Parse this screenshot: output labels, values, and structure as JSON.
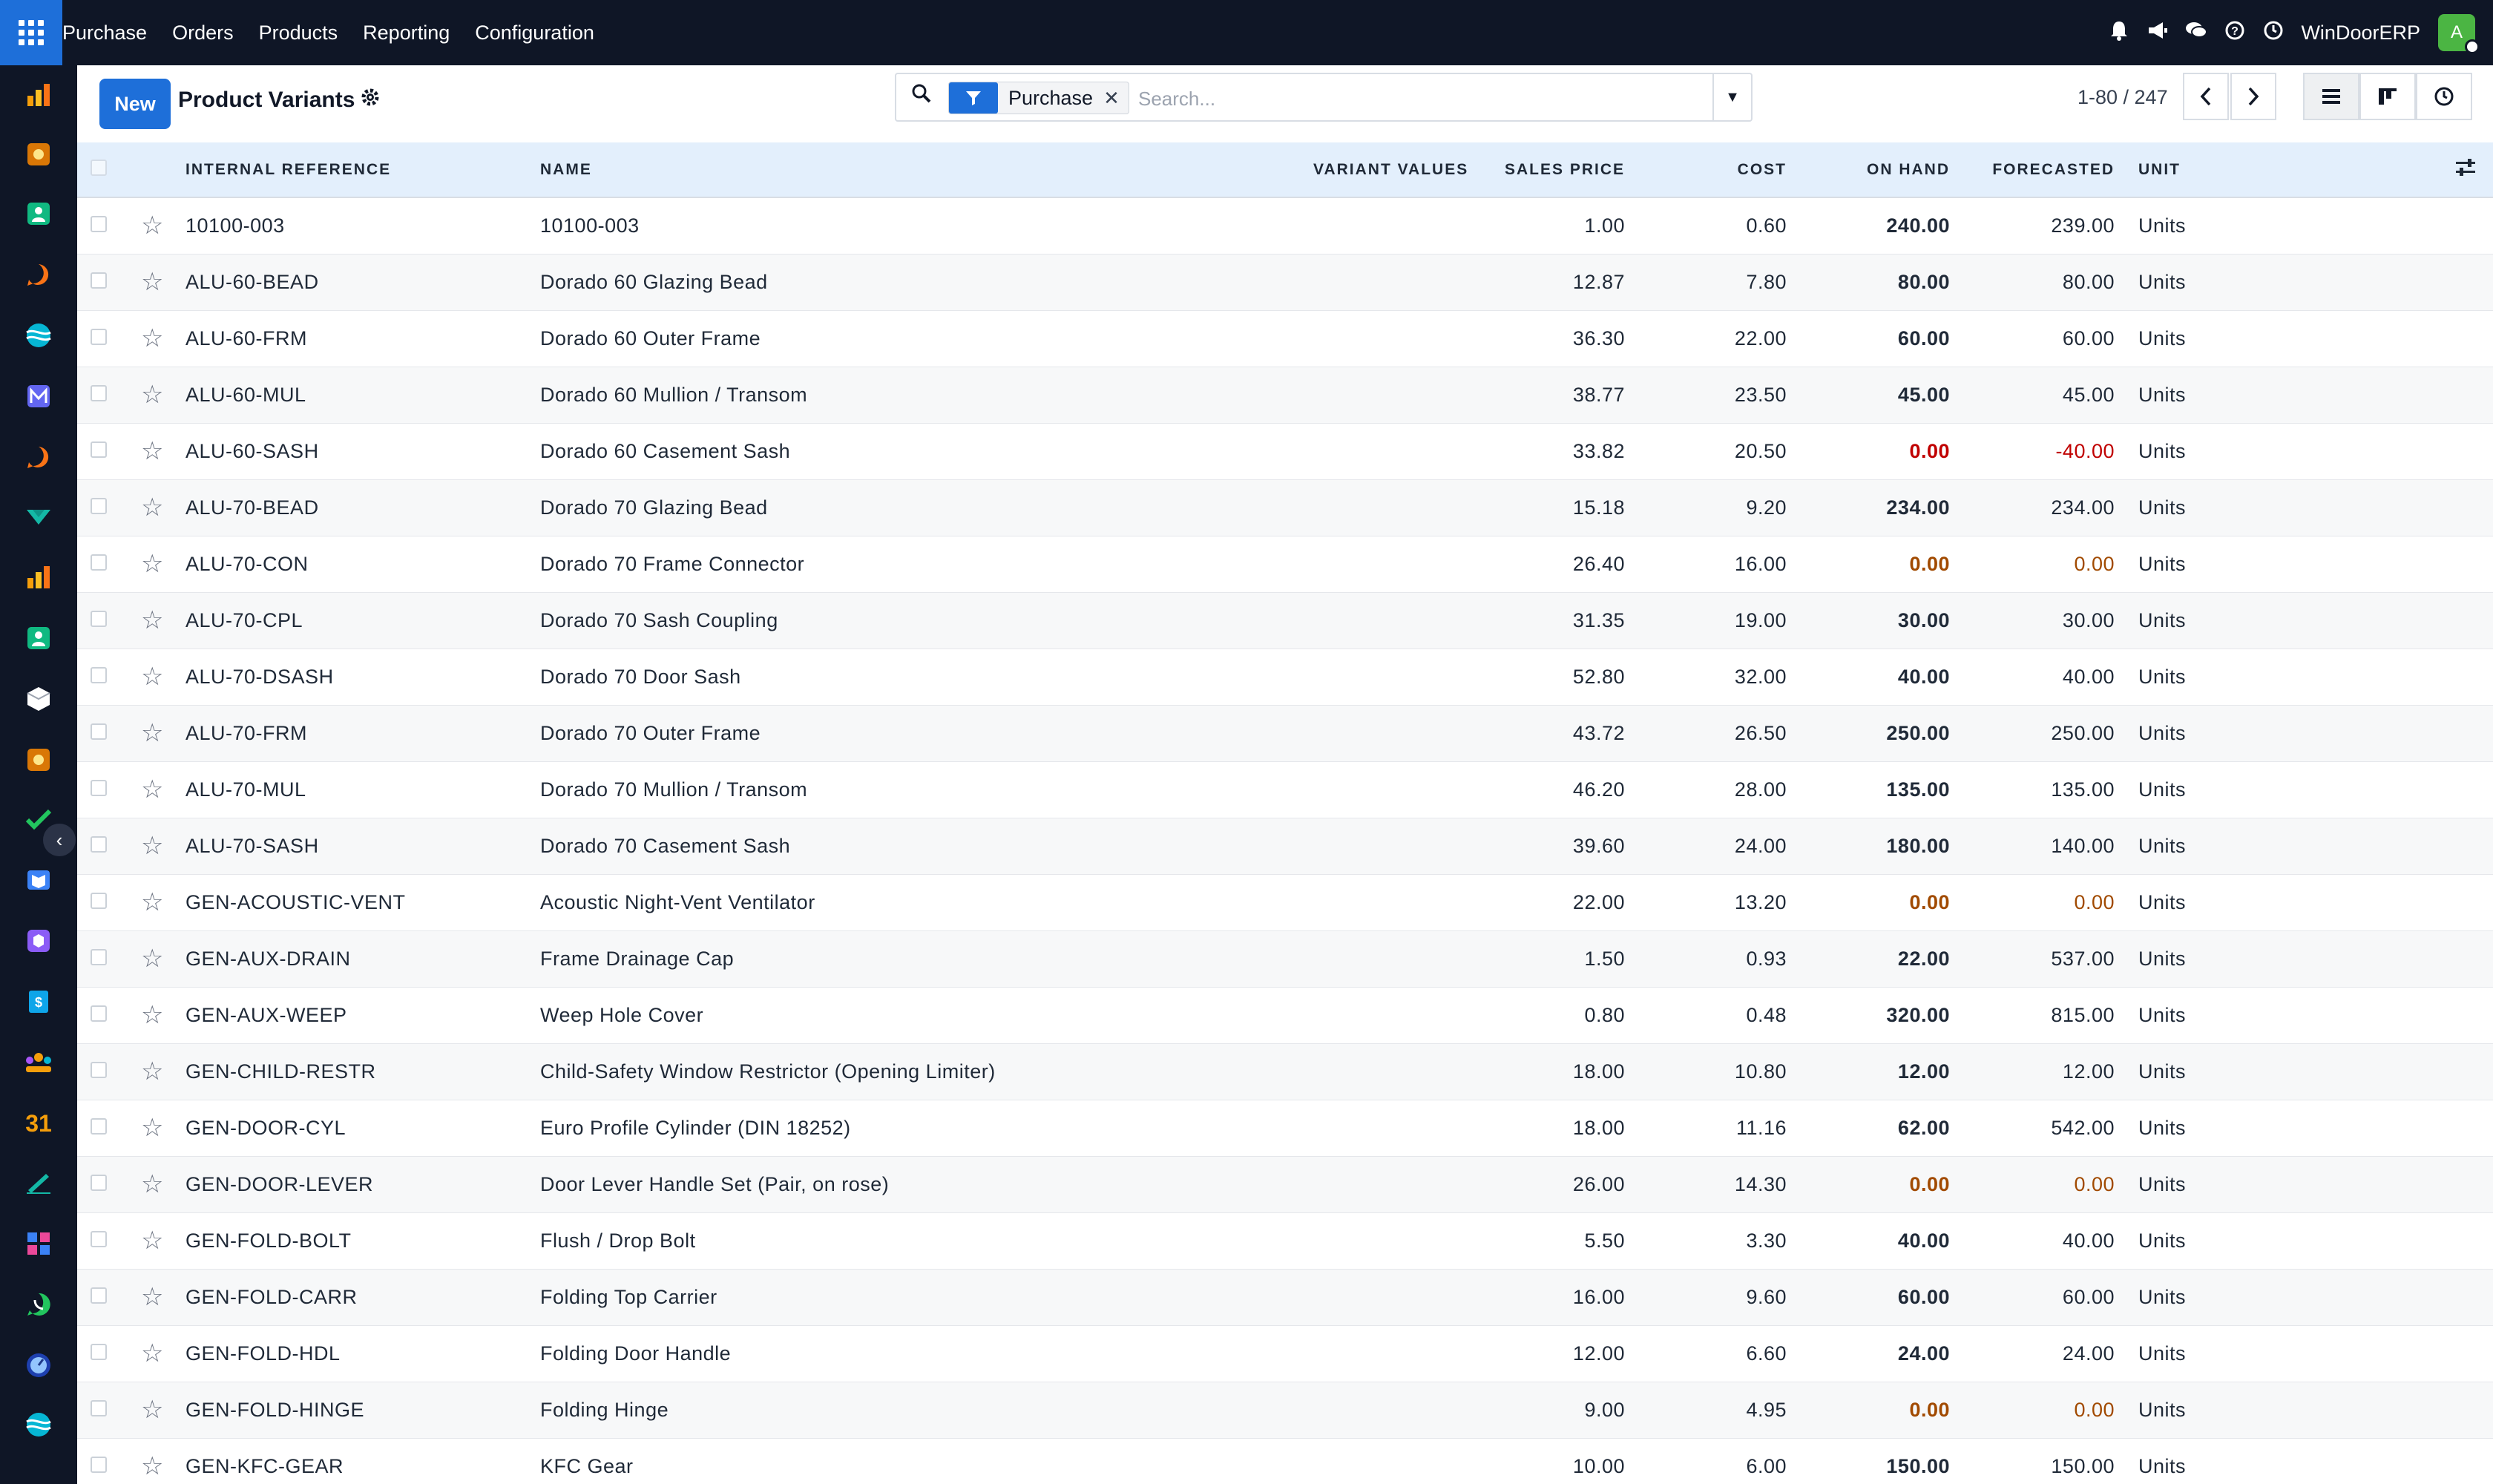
{
  "nav": {
    "brand": "Purchase",
    "menu": [
      "Orders",
      "Products",
      "Reporting",
      "Configuration"
    ],
    "company": "WinDoorERP",
    "avatar_initial": "A",
    "icons": [
      "bell-icon",
      "megaphone-icon",
      "chat-icon",
      "help-icon",
      "clock-icon"
    ]
  },
  "sidebar": {
    "apps": [
      {
        "name": "reporting-app-icon",
        "color": "#f59e0b"
      },
      {
        "name": "studio-app-icon",
        "color": "#d97706"
      },
      {
        "name": "contacts-app-icon",
        "color": "#10b981"
      },
      {
        "name": "discuss-app-icon",
        "color": "#f97316"
      },
      {
        "name": "website-app-icon",
        "color": "#06b6d4"
      },
      {
        "name": "mail-app-icon",
        "color": "#6366f1"
      },
      {
        "name": "livechat-app-icon",
        "color": "#f97316"
      },
      {
        "name": "sign-app-icon",
        "color": "#14b8a6"
      },
      {
        "name": "dashboards-app-icon",
        "color": "#f59e0b"
      },
      {
        "name": "employees-app-icon",
        "color": "#10b981"
      },
      {
        "name": "inventory-app-icon",
        "color": "#ffffff"
      },
      {
        "name": "studio2-app-icon",
        "color": "#d97706"
      },
      {
        "name": "project-app-icon",
        "color": "#22c55e"
      },
      {
        "name": "knowledge-app-icon",
        "color": "#3b82f6"
      },
      {
        "name": "repair-app-icon",
        "color": "#8b5cf6"
      },
      {
        "name": "invoicing-app-icon",
        "color": "#0ea5e9"
      },
      {
        "name": "crm-app-icon",
        "color": "#f59e0b"
      },
      {
        "name": "calendar-app-icon",
        "color": "#f59e0b"
      },
      {
        "name": "signature-app-icon",
        "color": "#14b8a6"
      },
      {
        "name": "spreadsheet-app-icon",
        "color": "#3b82f6"
      },
      {
        "name": "whatsapp-app-icon",
        "color": "#22c55e"
      },
      {
        "name": "timer-app-icon",
        "color": "#3b82f6"
      },
      {
        "name": "website2-app-icon",
        "color": "#06b6d4"
      }
    ]
  },
  "control": {
    "new_label": "New",
    "title": "Product Variants",
    "facet_label": "Purchase",
    "search_placeholder": "Search...",
    "pager": "1-80 / 247"
  },
  "table": {
    "headers": [
      "INTERNAL REFERENCE",
      "NAME",
      "VARIANT VALUES",
      "SALES PRICE",
      "COST",
      "ON HAND",
      "FORECASTED",
      "UNIT"
    ],
    "rows": [
      {
        "ref": "10100-003",
        "name": "10100-003",
        "variant": "",
        "price": "1.00",
        "cost": "0.60",
        "onhand": "240.00",
        "forecast": "239.00",
        "unit": "Units",
        "status": "ok"
      },
      {
        "ref": "ALU-60-BEAD",
        "name": "Dorado 60 Glazing Bead",
        "variant": "",
        "price": "12.87",
        "cost": "7.80",
        "onhand": "80.00",
        "forecast": "80.00",
        "unit": "Units",
        "status": "ok"
      },
      {
        "ref": "ALU-60-FRM",
        "name": "Dorado 60 Outer Frame",
        "variant": "",
        "price": "36.30",
        "cost": "22.00",
        "onhand": "60.00",
        "forecast": "60.00",
        "unit": "Units",
        "status": "ok"
      },
      {
        "ref": "ALU-60-MUL",
        "name": "Dorado 60 Mullion / Transom",
        "variant": "",
        "price": "38.77",
        "cost": "23.50",
        "onhand": "45.00",
        "forecast": "45.00",
        "unit": "Units",
        "status": "ok"
      },
      {
        "ref": "ALU-60-SASH",
        "name": "Dorado 60 Casement Sash",
        "variant": "",
        "price": "33.82",
        "cost": "20.50",
        "onhand": "0.00",
        "forecast": "-40.00",
        "unit": "Units",
        "status": "negative"
      },
      {
        "ref": "ALU-70-BEAD",
        "name": "Dorado 70 Glazing Bead",
        "variant": "",
        "price": "15.18",
        "cost": "9.20",
        "onhand": "234.00",
        "forecast": "234.00",
        "unit": "Units",
        "status": "ok"
      },
      {
        "ref": "ALU-70-CON",
        "name": "Dorado 70 Frame Connector",
        "variant": "",
        "price": "26.40",
        "cost": "16.00",
        "onhand": "0.00",
        "forecast": "0.00",
        "unit": "Units",
        "status": "zero"
      },
      {
        "ref": "ALU-70-CPL",
        "name": "Dorado 70 Sash Coupling",
        "variant": "",
        "price": "31.35",
        "cost": "19.00",
        "onhand": "30.00",
        "forecast": "30.00",
        "unit": "Units",
        "status": "ok"
      },
      {
        "ref": "ALU-70-DSASH",
        "name": "Dorado 70 Door Sash",
        "variant": "",
        "price": "52.80",
        "cost": "32.00",
        "onhand": "40.00",
        "forecast": "40.00",
        "unit": "Units",
        "status": "ok"
      },
      {
        "ref": "ALU-70-FRM",
        "name": "Dorado 70 Outer Frame",
        "variant": "",
        "price": "43.72",
        "cost": "26.50",
        "onhand": "250.00",
        "forecast": "250.00",
        "unit": "Units",
        "status": "ok"
      },
      {
        "ref": "ALU-70-MUL",
        "name": "Dorado 70 Mullion / Transom",
        "variant": "",
        "price": "46.20",
        "cost": "28.00",
        "onhand": "135.00",
        "forecast": "135.00",
        "unit": "Units",
        "status": "ok"
      },
      {
        "ref": "ALU-70-SASH",
        "name": "Dorado 70 Casement Sash",
        "variant": "",
        "price": "39.60",
        "cost": "24.00",
        "onhand": "180.00",
        "forecast": "140.00",
        "unit": "Units",
        "status": "ok"
      },
      {
        "ref": "GEN-ACOUSTIC-VENT",
        "name": "Acoustic Night-Vent Ventilator",
        "variant": "",
        "price": "22.00",
        "cost": "13.20",
        "onhand": "0.00",
        "forecast": "0.00",
        "unit": "Units",
        "status": "zero"
      },
      {
        "ref": "GEN-AUX-DRAIN",
        "name": "Frame Drainage Cap",
        "variant": "",
        "price": "1.50",
        "cost": "0.93",
        "onhand": "22.00",
        "forecast": "537.00",
        "unit": "Units",
        "status": "ok"
      },
      {
        "ref": "GEN-AUX-WEEP",
        "name": "Weep Hole Cover",
        "variant": "",
        "price": "0.80",
        "cost": "0.48",
        "onhand": "320.00",
        "forecast": "815.00",
        "unit": "Units",
        "status": "ok"
      },
      {
        "ref": "GEN-CHILD-RESTR",
        "name": "Child-Safety Window Restrictor (Opening Limiter)",
        "variant": "",
        "price": "18.00",
        "cost": "10.80",
        "onhand": "12.00",
        "forecast": "12.00",
        "unit": "Units",
        "status": "ok"
      },
      {
        "ref": "GEN-DOOR-CYL",
        "name": "Euro Profile Cylinder (DIN 18252)",
        "variant": "",
        "price": "18.00",
        "cost": "11.16",
        "onhand": "62.00",
        "forecast": "542.00",
        "unit": "Units",
        "status": "ok"
      },
      {
        "ref": "GEN-DOOR-LEVER",
        "name": "Door Lever Handle Set (Pair, on rose)",
        "variant": "",
        "price": "26.00",
        "cost": "14.30",
        "onhand": "0.00",
        "forecast": "0.00",
        "unit": "Units",
        "status": "zero"
      },
      {
        "ref": "GEN-FOLD-BOLT",
        "name": "Flush / Drop Bolt",
        "variant": "",
        "price": "5.50",
        "cost": "3.30",
        "onhand": "40.00",
        "forecast": "40.00",
        "unit": "Units",
        "status": "ok"
      },
      {
        "ref": "GEN-FOLD-CARR",
        "name": "Folding Top Carrier",
        "variant": "",
        "price": "16.00",
        "cost": "9.60",
        "onhand": "60.00",
        "forecast": "60.00",
        "unit": "Units",
        "status": "ok"
      },
      {
        "ref": "GEN-FOLD-HDL",
        "name": "Folding Door Handle",
        "variant": "",
        "price": "12.00",
        "cost": "6.60",
        "onhand": "24.00",
        "forecast": "24.00",
        "unit": "Units",
        "status": "ok"
      },
      {
        "ref": "GEN-FOLD-HINGE",
        "name": "Folding Hinge",
        "variant": "",
        "price": "9.00",
        "cost": "4.95",
        "onhand": "0.00",
        "forecast": "0.00",
        "unit": "Units",
        "status": "zero"
      },
      {
        "ref": "GEN-KFC-GEAR",
        "name": "KFC Gear",
        "variant": "",
        "price": "10.00",
        "cost": "6.00",
        "onhand": "150.00",
        "forecast": "150.00",
        "unit": "Units",
        "status": "ok"
      }
    ]
  },
  "colors": {
    "navbar": "#0f1626",
    "primary": "#1e6fd9",
    "header_row": "#e3effc",
    "negative": "#c00000",
    "zero": "#a14a00"
  }
}
